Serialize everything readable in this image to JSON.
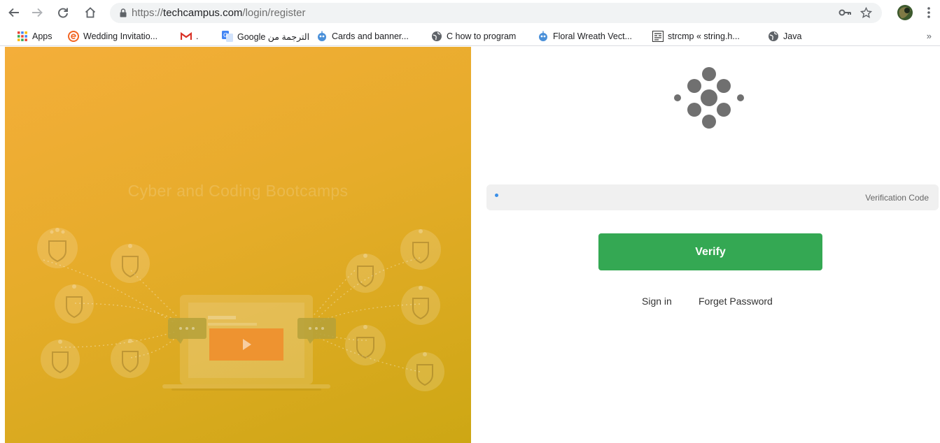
{
  "browser": {
    "url_protocol": "https://",
    "url_host": "techcampus.com",
    "url_path": "/login/register"
  },
  "bookmarks": [
    {
      "label": "Apps",
      "icon": "apps-grid-icon"
    },
    {
      "label": "Wedding Invitatio...",
      "icon": "e-logo-icon"
    },
    {
      "label": ".",
      "icon": "gmail-icon"
    },
    {
      "label": "Google الترجمة من",
      "icon": "google-translate-icon"
    },
    {
      "label": "Cards and banner...",
      "icon": "robot-icon"
    },
    {
      "label": "C how to program",
      "icon": "globe-icon"
    },
    {
      "label": "Floral Wreath Vect...",
      "icon": "robot-icon"
    },
    {
      "label": "strcmp « string.h...",
      "icon": "doc-icon"
    },
    {
      "label": "Java",
      "icon": "globe-icon"
    }
  ],
  "bookmarks_more": "»",
  "hero": {
    "title": "Cyber and Coding Bootcamps"
  },
  "form": {
    "code_placeholder": "Verification Code",
    "verify_label": "Verify",
    "sign_in_label": "Sign in",
    "forget_password_label": "Forget Password"
  },
  "colors": {
    "accent_green": "#34a853",
    "hero_gradient_start": "#f4ae3a",
    "hero_gradient_end": "#cda714",
    "logo_gray": "#6f6f6f"
  }
}
